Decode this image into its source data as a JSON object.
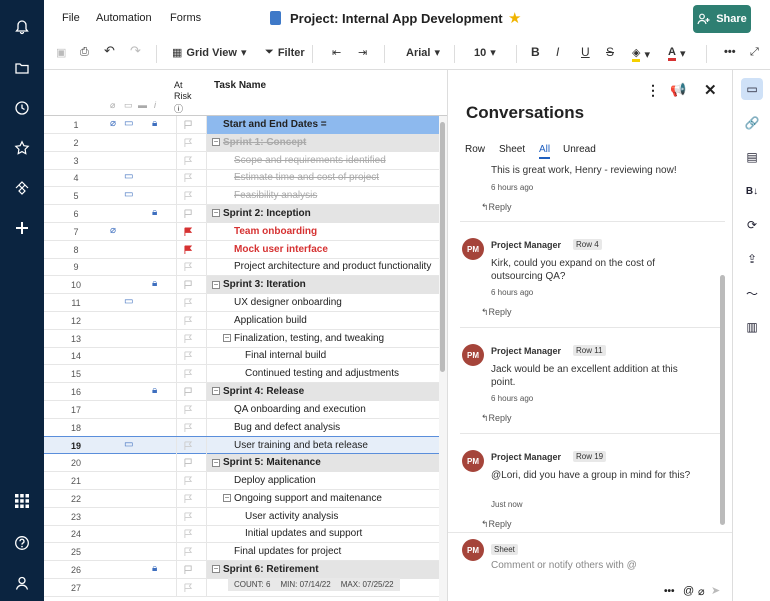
{
  "app": {
    "menus": [
      "File",
      "Automation",
      "Forms"
    ],
    "title": "Project: Internal App Development",
    "share_label": "Share"
  },
  "toolbar": {
    "view_label": "Grid View",
    "filter_label": "Filter",
    "font": "Arial",
    "font_size": "10"
  },
  "grid": {
    "at_risk_header": "At Risk",
    "task_header": "Task Name",
    "rows": [
      {
        "n": "1",
        "task": "Start and End Dates =",
        "style": "bold",
        "level": 0,
        "attach": true,
        "comment": true,
        "lock": true,
        "flag": "white",
        "sel": true
      },
      {
        "n": "2",
        "task": "Sprint 1: Concept",
        "style": "bold-struck",
        "level": 0,
        "toggle": true,
        "flag": "none",
        "section": true
      },
      {
        "n": "3",
        "task": "Scope and requirements identified",
        "style": "struck",
        "level": 1,
        "flag": "none"
      },
      {
        "n": "4",
        "task": "Estimate time and cost of project",
        "style": "struck",
        "level": 1,
        "comment": true,
        "flag": "none"
      },
      {
        "n": "5",
        "task": "Feasibility analysis",
        "style": "struck",
        "level": 1,
        "comment": true,
        "flag": "none"
      },
      {
        "n": "6",
        "task": "Sprint 2: Inception",
        "style": "bold",
        "level": 0,
        "toggle": true,
        "lock": true,
        "flag": "white",
        "section": true
      },
      {
        "n": "7",
        "task": "Team onboarding",
        "style": "red",
        "level": 1,
        "attach": true,
        "flag": "red"
      },
      {
        "n": "8",
        "task": "Mock user interface",
        "style": "red",
        "level": 1,
        "flag": "red"
      },
      {
        "n": "9",
        "task": "Project architecture and product functionality",
        "style": "normal",
        "level": 1,
        "flag": "none"
      },
      {
        "n": "10",
        "task": "Sprint 3: Iteration",
        "style": "bold",
        "level": 0,
        "toggle": true,
        "lock": true,
        "flag": "white",
        "section": true
      },
      {
        "n": "11",
        "task": "UX designer onboarding",
        "style": "normal",
        "level": 1,
        "comment": true,
        "flag": "none"
      },
      {
        "n": "12",
        "task": "Application build",
        "style": "normal",
        "level": 1,
        "flag": "none"
      },
      {
        "n": "13",
        "task": "Finalization, testing, and tweaking",
        "style": "normal",
        "level": 1,
        "toggle": true,
        "flag": "none"
      },
      {
        "n": "14",
        "task": "Final internal build",
        "style": "normal",
        "level": 2,
        "flag": "none"
      },
      {
        "n": "15",
        "task": "Continued testing and adjustments",
        "style": "normal",
        "level": 2,
        "flag": "none"
      },
      {
        "n": "16",
        "task": "Sprint 4: Release",
        "style": "bold",
        "level": 0,
        "toggle": true,
        "lock": true,
        "flag": "white",
        "section": true
      },
      {
        "n": "17",
        "task": "QA onboarding and execution",
        "style": "normal",
        "level": 1,
        "flag": "none"
      },
      {
        "n": "18",
        "task": "Bug and defect analysis",
        "style": "normal",
        "level": 1,
        "flag": "none"
      },
      {
        "n": "19",
        "task": "User training and beta release",
        "style": "normal",
        "level": 1,
        "comment": true,
        "flag": "none",
        "active": true
      },
      {
        "n": "20",
        "task": "Sprint 5: Maitenance",
        "style": "bold",
        "level": 0,
        "toggle": true,
        "flag": "white",
        "section": true
      },
      {
        "n": "21",
        "task": "Deploy application",
        "style": "normal",
        "level": 1,
        "flag": "none"
      },
      {
        "n": "22",
        "task": "Ongoing support and maitenance",
        "style": "normal",
        "level": 1,
        "toggle": true,
        "flag": "none"
      },
      {
        "n": "23",
        "task": "User activity analysis",
        "style": "normal",
        "level": 2,
        "flag": "none"
      },
      {
        "n": "24",
        "task": "Initial updates and support",
        "style": "normal",
        "level": 2,
        "flag": "none"
      },
      {
        "n": "25",
        "task": "Final updates for project",
        "style": "normal",
        "level": 1,
        "flag": "none"
      },
      {
        "n": "26",
        "task": "Sprint 6: Retirement",
        "style": "bold",
        "level": 0,
        "toggle": true,
        "lock": true,
        "flag": "white",
        "section": true
      },
      {
        "n": "27",
        "task": "",
        "style": "normal",
        "level": 1,
        "flag": "none"
      }
    ],
    "summary": {
      "count": "COUNT:  6",
      "min": "MIN:  07/14/22",
      "max": "MAX:  07/25/22"
    }
  },
  "conversations": {
    "title": "Conversations",
    "tabs": [
      "Row",
      "Sheet",
      "All",
      "Unread"
    ],
    "active_tab": "All",
    "first": {
      "text": "This is great work, Henry - reviewing now!",
      "time": "6 hours ago"
    },
    "comments": [
      {
        "initials": "PM",
        "author": "Project Manager",
        "tag": "Row 4",
        "text": [
          "Kirk, could you expand on the cost of",
          "outsourcing QA?"
        ],
        "time": "6 hours ago"
      },
      {
        "initials": "PM",
        "author": "Project Manager",
        "tag": "Row 11",
        "text": [
          "Jack would be an excellent addition at this",
          "point."
        ],
        "time": "6 hours ago"
      },
      {
        "initials": "PM",
        "author": "Project Manager",
        "tag": "Row 19",
        "text": [
          "@Lori, did you have a group in mind for this?"
        ],
        "time": "Just now"
      }
    ],
    "reply_label": "Reply",
    "compose": {
      "initials": "PM",
      "tag": "Sheet",
      "placeholder": "Comment or notify others with @"
    }
  },
  "colors": {
    "nav": "#0b2440",
    "accent": "#2e7f72",
    "selection": "#8db9ee",
    "red_text": "#d63232",
    "avatar": "#a5443a"
  }
}
